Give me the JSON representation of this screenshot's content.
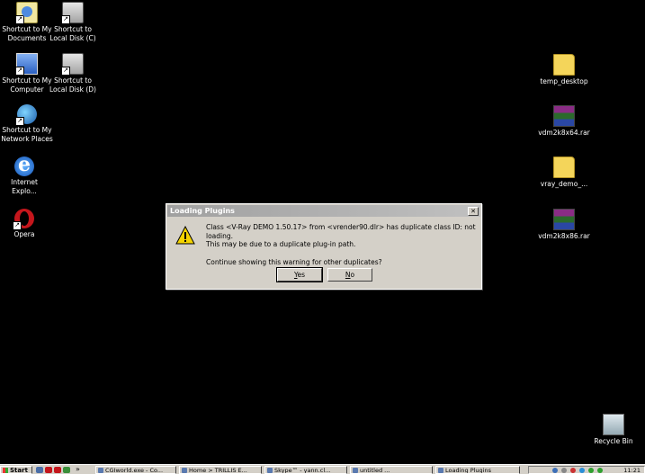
{
  "desktop": {
    "icons": [
      {
        "label": "Shortcut to My\nDocuments"
      },
      {
        "label": "Shortcut to\nLocal Disk (C)"
      },
      {
        "label": "Shortcut to My\nComputer"
      },
      {
        "label": "Shortcut to\nLocal Disk (D)"
      },
      {
        "label": "Shortcut to My\nNetwork Places"
      },
      {
        "label": "Internet\nExplo..."
      },
      {
        "label": "Opera"
      },
      {
        "label": "temp_desktop"
      },
      {
        "label": "vdm2k8x64.rar"
      },
      {
        "label": "vray_demo_..."
      },
      {
        "label": "vdm2k8x86.rar"
      },
      {
        "label": "Recycle Bin"
      }
    ]
  },
  "dialog": {
    "title": "Loading Plugins",
    "message_line1": "Class <V-Ray DEMO 1.50.17> from <vrender90.dlr>  has duplicate class ID: not loading.",
    "message_line2": "This may be due to a duplicate plug-in path.",
    "question": "Continue showing this warning for other duplicates?",
    "yes_label": "es",
    "yes_mnemonic": "Y",
    "no_label": "o",
    "no_mnemonic": "N",
    "close_glyph": "✕"
  },
  "taskbar": {
    "start_label": "Start",
    "overflow_label": "»",
    "tasks": [
      {
        "label": "CGIworld.exe - Co..."
      },
      {
        "label": "Home > TRILLIS E..."
      },
      {
        "label": "Skype™ - yann.cl..."
      },
      {
        "label": "untitled ..."
      },
      {
        "label": "Loading Plugins"
      }
    ],
    "clock": "11:21"
  },
  "colors": {
    "desktop_bg": "#000000",
    "dialog_bg": "#d4d0c8",
    "titlebar_inactive": "#a0a0a0"
  }
}
